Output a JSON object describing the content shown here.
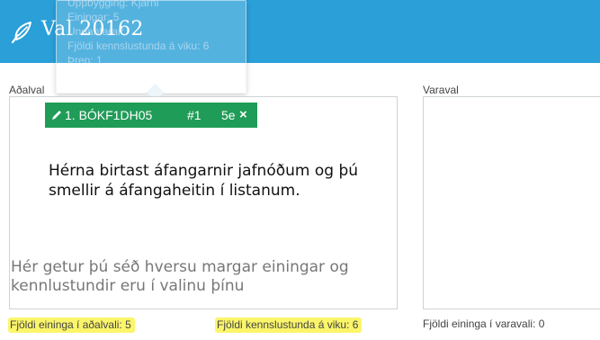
{
  "header": {
    "title": "Val 20162",
    "icon": "feather-icon"
  },
  "tooltip": {
    "lines": [
      "Uppbygging: Kjarni",
      "Einingar: 5",
      "Undanfarar:",
      "Fjöldi kennslustunda á viku: 6",
      "Þrep: 1"
    ]
  },
  "main_panel": {
    "label": "Aðalval",
    "course": {
      "code": "1. BÓKF1DH05",
      "number": "#1",
      "units": "5e",
      "close_icon": "×"
    }
  },
  "reserve_panel": {
    "label": "Varaval"
  },
  "annotations": {
    "course_hint": "Hérna birtast áfangarnir jafnóðum og þú smellir á áfangaheitin í listanum.",
    "totals_hint": "Hér getur þú séð hversu margar einingar og kennlustundir eru í valinu þínu"
  },
  "stats": {
    "main_units": "Fjöldi eininga í aðalvali: 5",
    "lessons_per_week": "Fjöldi kennslustunda á viku: 6",
    "reserve_units": "Fjöldi eininga í varavali: 0"
  },
  "colors": {
    "header": "#2a9fd8",
    "course": "#1f9c57",
    "highlight": "#fbf56a"
  }
}
